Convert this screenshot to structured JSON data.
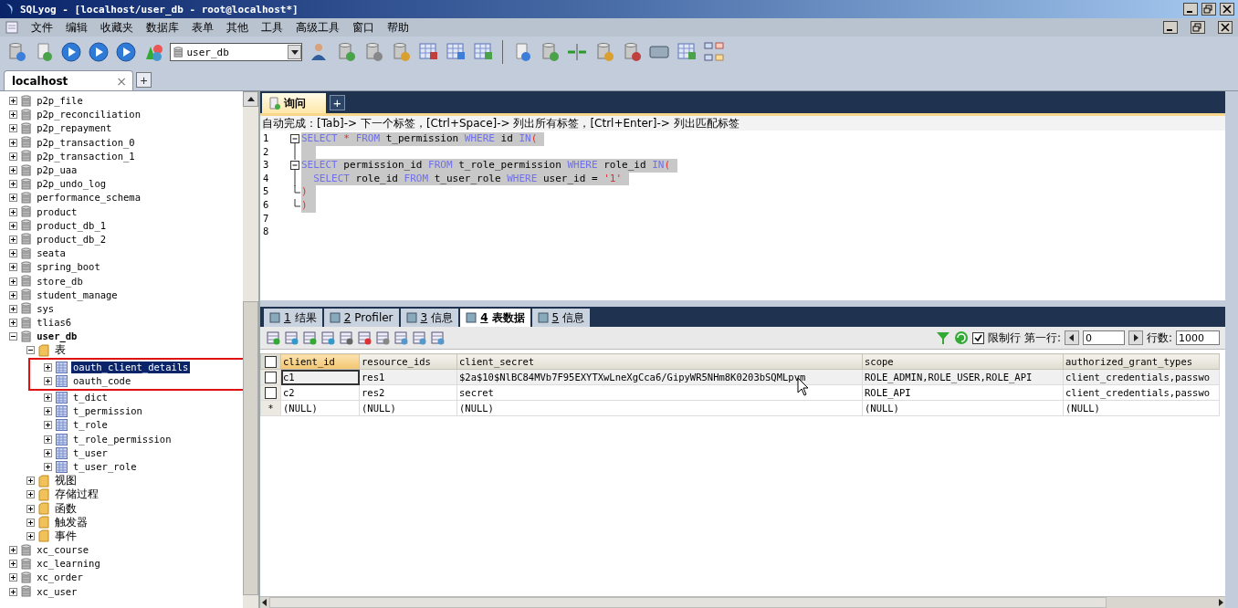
{
  "window": {
    "title": "SQLyog - [localhost/user_db - root@localhost*]"
  },
  "menu": [
    "文件",
    "编辑",
    "收藏夹",
    "数据库",
    "表单",
    "其他",
    "工具",
    "高级工具",
    "窗口",
    "帮助"
  ],
  "toolbar": {
    "database_select": "user_db"
  },
  "connection_tabs": [
    {
      "label": "localhost",
      "close": "×",
      "selected": true
    }
  ],
  "new_connection_tab": "+",
  "object_browser": {
    "items": [
      {
        "label": "p2p_file",
        "kind": "database",
        "expanded": false,
        "selected": false
      },
      {
        "label": "p2p_reconciliation",
        "kind": "database",
        "expanded": false,
        "selected": false
      },
      {
        "label": "p2p_repayment",
        "kind": "database",
        "expanded": false,
        "selected": false
      },
      {
        "label": "p2p_transaction_0",
        "kind": "database",
        "expanded": false,
        "selected": false
      },
      {
        "label": "p2p_transaction_1",
        "kind": "database",
        "expanded": false,
        "selected": false
      },
      {
        "label": "p2p_uaa",
        "kind": "database",
        "expanded": false,
        "selected": false
      },
      {
        "label": "p2p_undo_log",
        "kind": "database",
        "expanded": false,
        "selected": false
      },
      {
        "label": "performance_schema",
        "kind": "database",
        "expanded": false,
        "selected": false
      },
      {
        "label": "product",
        "kind": "database",
        "expanded": false,
        "selected": false
      },
      {
        "label": "product_db_1",
        "kind": "database",
        "expanded": false,
        "selected": false
      },
      {
        "label": "product_db_2",
        "kind": "database",
        "expanded": false,
        "selected": false
      },
      {
        "label": "seata",
        "kind": "database",
        "expanded": false,
        "selected": false
      },
      {
        "label": "spring_boot",
        "kind": "database",
        "expanded": false,
        "selected": false
      },
      {
        "label": "store_db",
        "kind": "database",
        "expanded": false,
        "selected": false
      },
      {
        "label": "student_manage",
        "kind": "database",
        "expanded": false,
        "selected": false
      },
      {
        "label": "sys",
        "kind": "database",
        "expanded": false,
        "selected": false
      },
      {
        "label": "tlias6",
        "kind": "database",
        "expanded": false,
        "selected": false
      },
      {
        "label": "user_db",
        "kind": "database",
        "expanded": true,
        "selected": false,
        "current": true,
        "children": [
          {
            "label": "表",
            "kind": "folder",
            "expanded": true,
            "selected": false,
            "children": [
              {
                "label": "oauth_client_details",
                "kind": "table",
                "expanded": false,
                "selected": true,
                "marked": true
              },
              {
                "label": "oauth_code",
                "kind": "table",
                "expanded": false,
                "selected": false,
                "marked": true
              },
              {
                "label": "t_dict",
                "kind": "table",
                "expanded": false,
                "selected": false,
                "marked": false
              },
              {
                "label": "t_permission",
                "kind": "table",
                "expanded": false,
                "selected": false,
                "marked": false
              },
              {
                "label": "t_role",
                "kind": "table",
                "expanded": false,
                "selected": false,
                "marked": false
              },
              {
                "label": "t_role_permission",
                "kind": "table",
                "expanded": false,
                "selected": false,
                "marked": false
              },
              {
                "label": "t_user",
                "kind": "table",
                "expanded": false,
                "selected": false,
                "marked": false
              },
              {
                "label": "t_user_role",
                "kind": "table",
                "expanded": false,
                "selected": false,
                "marked": false
              }
            ]
          },
          {
            "label": "视图",
            "kind": "folder",
            "expanded": false,
            "selected": false
          },
          {
            "label": "存储过程",
            "kind": "folder",
            "expanded": false,
            "selected": false
          },
          {
            "label": "函数",
            "kind": "folder",
            "expanded": false,
            "selected": false
          },
          {
            "label": "触发器",
            "kind": "folder",
            "expanded": false,
            "selected": false
          },
          {
            "label": "事件",
            "kind": "folder",
            "expanded": false,
            "selected": false
          }
        ]
      },
      {
        "label": "xc_course",
        "kind": "database",
        "expanded": false,
        "selected": false
      },
      {
        "label": "xc_learning",
        "kind": "database",
        "expanded": false,
        "selected": false
      },
      {
        "label": "xc_order",
        "kind": "database",
        "expanded": false,
        "selected": false
      },
      {
        "label": "xc_user",
        "kind": "database",
        "expanded": false,
        "selected": false
      }
    ]
  },
  "query_tabs": [
    {
      "label": "询问",
      "selected": true
    }
  ],
  "new_query_tab": "+",
  "autocomplete_hint": "自动完成：[Tab]-> 下一个标签，[Ctrl+Space]-> 列出所有标签，[Ctrl+Enter]-> 列出匹配标签",
  "editor": {
    "lines": [
      {
        "number": "1",
        "kind": "fold-start",
        "selected": true,
        "tokens": [
          {
            "kind": "keyword",
            "text": "SELECT"
          },
          {
            "kind": "operator",
            "text": " * "
          },
          {
            "kind": "keyword",
            "text": "FROM"
          },
          {
            "kind": "plain",
            "text": " t_permission "
          },
          {
            "kind": "keyword",
            "text": "WHERE"
          },
          {
            "kind": "plain",
            "text": " id "
          },
          {
            "kind": "keyword",
            "text": "IN"
          },
          {
            "kind": "operator",
            "text": "("
          }
        ]
      },
      {
        "number": "2",
        "kind": "fold-inner",
        "selected": true
      },
      {
        "number": "3",
        "kind": "fold-start",
        "selected": true,
        "tokens": [
          {
            "kind": "keyword",
            "text": "SELECT"
          },
          {
            "kind": "plain",
            "text": " permission_id "
          },
          {
            "kind": "keyword",
            "text": "FROM"
          },
          {
            "kind": "plain",
            "text": " t_role_permission "
          },
          {
            "kind": "keyword",
            "text": "WHERE"
          },
          {
            "kind": "plain",
            "text": " role_id "
          },
          {
            "kind": "keyword",
            "text": "IN"
          },
          {
            "kind": "operator",
            "text": "("
          }
        ]
      },
      {
        "number": "4",
        "kind": "fold-inner",
        "selected": true,
        "tokens": [
          {
            "kind": "keyword",
            "text": "  SELECT"
          },
          {
            "kind": "plain",
            "text": " role_id "
          },
          {
            "kind": "keyword",
            "text": "FROM"
          },
          {
            "kind": "plain",
            "text": " t_user_role "
          },
          {
            "kind": "keyword",
            "text": "WHERE"
          },
          {
            "kind": "plain",
            "text": " user_id = "
          },
          {
            "kind": "string",
            "text": "'1'"
          }
        ]
      },
      {
        "number": "5",
        "kind": "fold-end",
        "selected": true,
        "tokens": [
          {
            "kind": "operator",
            "text": ")"
          }
        ]
      },
      {
        "number": "6",
        "kind": "fold-end",
        "selected": true,
        "tokens": [
          {
            "kind": "operator",
            "text": ")"
          }
        ]
      },
      {
        "number": "7",
        "kind": "plain",
        "selected": false
      },
      {
        "number": "8",
        "kind": "plain",
        "selected": false
      }
    ]
  },
  "result_tabs": [
    {
      "number": "1",
      "label": "结果",
      "selected": false
    },
    {
      "number": "2",
      "label": "Profiler",
      "selected": false
    },
    {
      "number": "3",
      "label": "信息",
      "selected": false
    },
    {
      "number": "4",
      "label": "表数据",
      "selected": true
    },
    {
      "number": "5",
      "label": "信息",
      "selected": false
    }
  ],
  "result_toolbar": {
    "limit_rows": {
      "label": "限制行",
      "checked": true
    },
    "first_row_label": "第一行:",
    "first_row": "0",
    "row_count_label": "行数:",
    "row_count": "1000"
  },
  "grid": {
    "select_all": {
      "checked": false
    },
    "columns": [
      {
        "label": "client_id",
        "selected": true
      },
      {
        "label": "resource_ids",
        "selected": false
      },
      {
        "label": "client_secret",
        "selected": false
      },
      {
        "label": "scope",
        "selected": false
      },
      {
        "label": "authorized_grant_types",
        "selected": false
      }
    ],
    "rows": [
      {
        "kind": "data",
        "checked": false,
        "selected": true,
        "cells": [
          "c1",
          "res1",
          "$2a$10$NlBC84MVb7F95EXYTXwLneXgCca6/GipyWR5NHm8K0203bSQMLpvm",
          "ROLE_ADMIN,ROLE_USER,ROLE_API",
          "client_credentials,passwo"
        ]
      },
      {
        "kind": "data",
        "checked": false,
        "selected": false,
        "cells": [
          "c2",
          "res2",
          "secret",
          "ROLE_API",
          "client_credentials,passwo"
        ]
      },
      {
        "kind": "new",
        "marker": "*",
        "selected": false,
        "cells": [
          "(NULL)",
          "(NULL)",
          "(NULL)",
          "(NULL)",
          "(NULL)"
        ]
      }
    ]
  }
}
